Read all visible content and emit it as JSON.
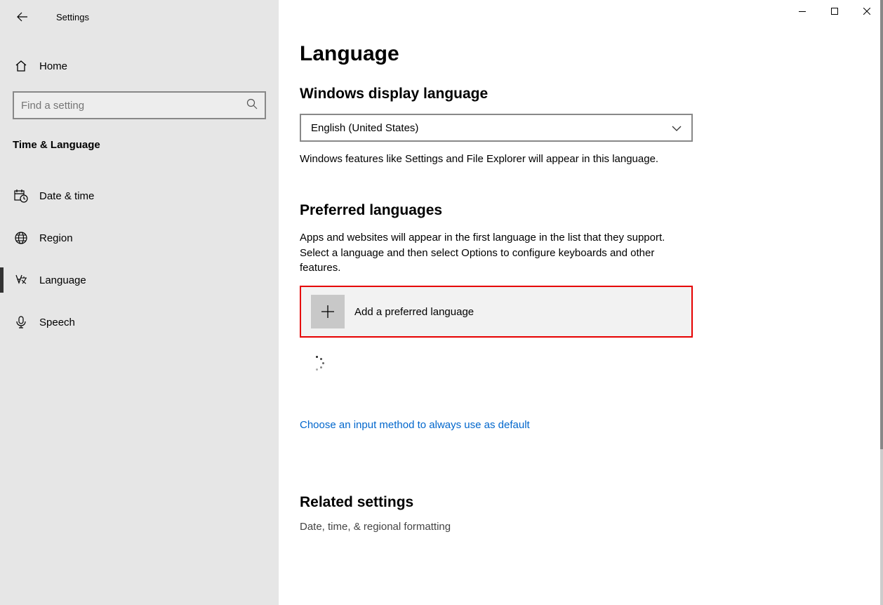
{
  "window": {
    "app_title": "Settings"
  },
  "sidebar": {
    "home_label": "Home",
    "search_placeholder": "Find a setting",
    "category": "Time & Language",
    "items": [
      {
        "label": "Date & time"
      },
      {
        "label": "Region"
      },
      {
        "label": "Language"
      },
      {
        "label": "Speech"
      }
    ]
  },
  "main": {
    "page_title": "Language",
    "display_lang": {
      "heading": "Windows display language",
      "selected": "English (United States)",
      "description": "Windows features like Settings and File Explorer will appear in this language."
    },
    "preferred": {
      "heading": "Preferred languages",
      "description": "Apps and websites will appear in the first language in the list that they support. Select a language and then select Options to configure keyboards and other features.",
      "add_label": "Add a preferred language"
    },
    "input_method_link": "Choose an input method to always use as default",
    "related": {
      "heading": "Related settings",
      "link1": "Date, time, & regional formatting"
    }
  }
}
